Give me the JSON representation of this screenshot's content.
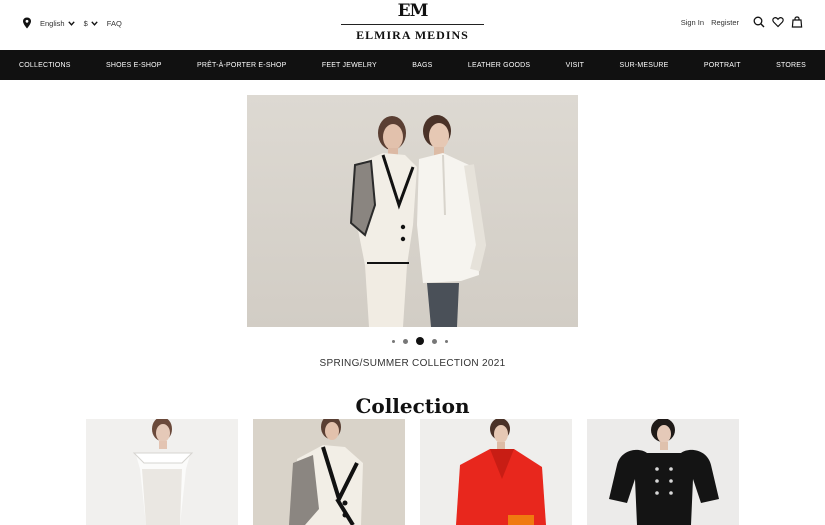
{
  "topbar": {
    "language": "English",
    "currency": "$",
    "faq": "FAQ",
    "sign_in": "Sign In",
    "register": "Register"
  },
  "logo": {
    "monogram": "EM",
    "name": "ELMIRA MEDINS"
  },
  "nav": {
    "items": [
      "COLLECTIONS",
      "SHOES E-SHOP",
      "PRÊT-À-PORTER E-SHOP",
      "FEET JEWELRY",
      "BAGS",
      "LEATHER GOODS",
      "VISIT",
      "SUR-MESURE",
      "PORTRAIT",
      "STORES"
    ]
  },
  "hero": {
    "caption": "SPRING/SUMMER COLLECTION 2021",
    "active_slide": 3,
    "slide_count": 5
  },
  "collection": {
    "title": "Collection"
  },
  "icons": [
    "location-pin-icon",
    "chevron-down-icon",
    "search-icon",
    "heart-icon",
    "shopping-bag-icon"
  ],
  "colors": {
    "nav_background": "#111111",
    "accent_red": "#e8271d"
  }
}
